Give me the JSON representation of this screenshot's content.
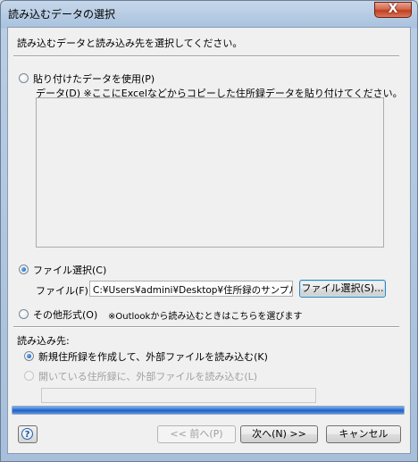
{
  "window": {
    "title": "読み込むデータの選択",
    "close_glyph": "X"
  },
  "instruction": "読み込むデータと読み込み先を選択してください。",
  "paste_option": {
    "label": "貼り付けたデータを使用(P)",
    "selected": false,
    "data_hint": "データ(D)  ※ここにExcelなどからコピーした住所録データを貼り付けてください。",
    "data_value": ""
  },
  "file_option": {
    "label": "ファイル選択(C)",
    "selected": true,
    "file_label": "ファイル(F)",
    "path_value": "C:¥Users¥admini¥Desktop¥住所録のサンプル",
    "browse_button": "ファイル選択(S)..."
  },
  "other_option": {
    "label": "その他形式(O)",
    "selected": false,
    "note": "※Outlookから読み込むときはこちらを選びます"
  },
  "destination": {
    "heading": "読み込み先:",
    "options": [
      {
        "label": "新規住所録を作成して、外部ファイルを読み込む(K)",
        "selected": true,
        "enabled": true
      },
      {
        "label": "開いている住所録に、外部ファイルを読み込む(L)",
        "selected": false,
        "enabled": false
      }
    ],
    "target_value": ""
  },
  "progress": {
    "fraction": 1.0
  },
  "footer": {
    "help_glyph": "?",
    "back_button": "<< 前へ(P)",
    "next_button": "次へ(N) >>",
    "cancel_button": "キャンセル"
  },
  "colors": {
    "accent": "#2a6fd0",
    "close": "#c23f1e"
  }
}
